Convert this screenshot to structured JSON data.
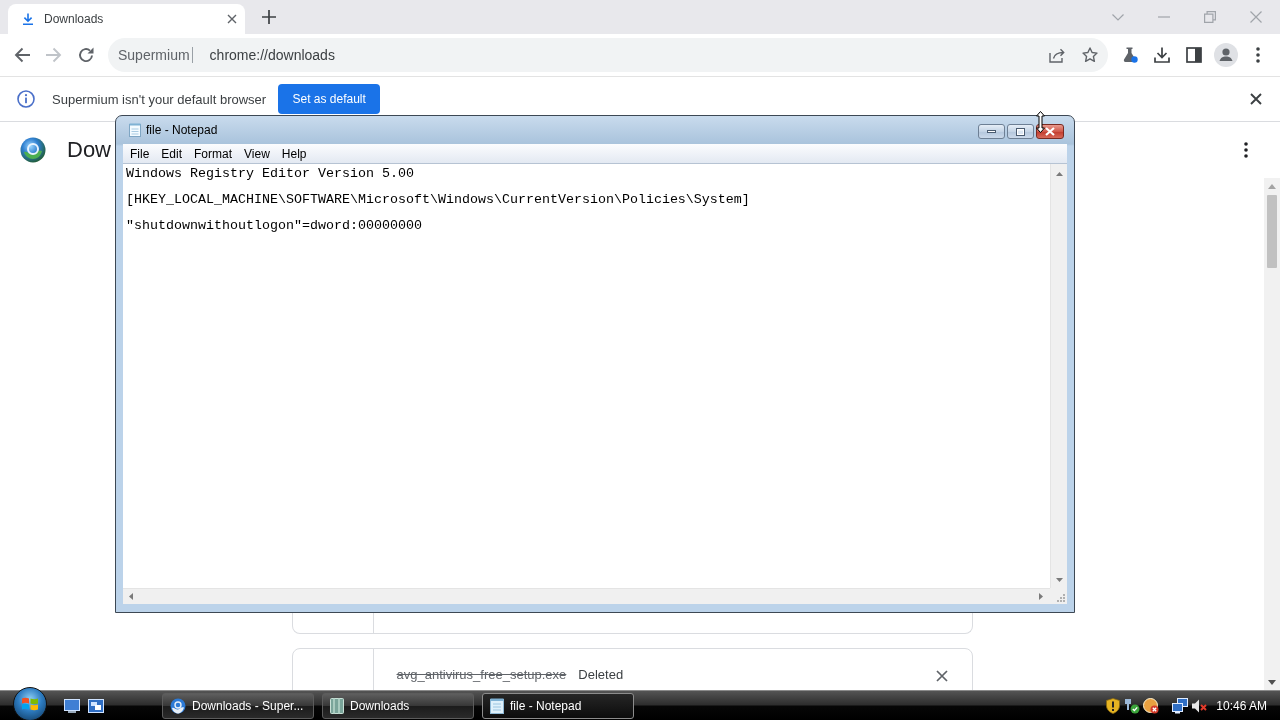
{
  "browser": {
    "tabs": [
      {
        "label": "Downloads",
        "selected": true
      }
    ],
    "nav_buttons": [
      {
        "kind": "back",
        "disabled": false
      },
      {
        "kind": "forward",
        "disabled": true
      },
      {
        "kind": "reload",
        "disabled": false
      }
    ],
    "address": {
      "site": "Supermium",
      "url": "chrome://downloads"
    },
    "infobar": {
      "message": "Supermium isn't your default browser",
      "button": "Set as default"
    }
  },
  "downloads_page": {
    "title": "Dow",
    "items": [
      {
        "file_name": "avg_antivirus_free_setup.exe",
        "status": "Deleted",
        "deleted": true
      }
    ]
  },
  "notepad": {
    "title": "file - Notepad",
    "menu": [
      "File",
      "Edit",
      "Format",
      "View",
      "Help"
    ],
    "lines": [
      "Windows Registry Editor Version 5.00",
      "[HKEY_LOCAL_MACHINE\\SOFTWARE\\Microsoft\\Windows\\CurrentVersion\\Policies\\System]",
      "\"shutdownwithoutlogon\"=dword:00000000"
    ]
  },
  "taskbar": {
    "buttons": [
      {
        "kind": "browser",
        "label": "Downloads - Super...",
        "selected": false
      },
      {
        "kind": "folder",
        "label": "Downloads",
        "selected": false
      },
      {
        "kind": "notepad",
        "label": "file - Notepad",
        "selected": true
      }
    ],
    "clock": "10:46 AM"
  }
}
